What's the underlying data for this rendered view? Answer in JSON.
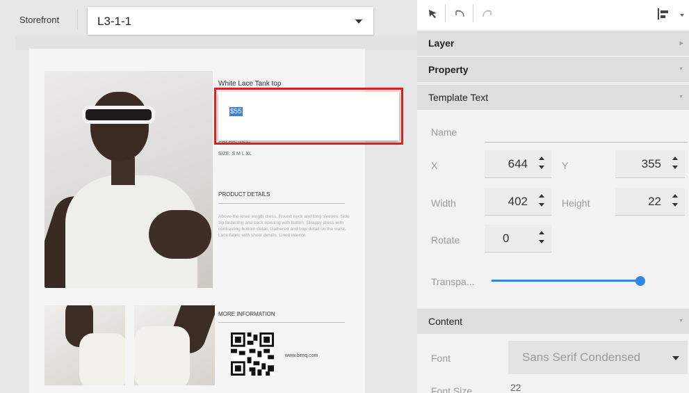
{
  "header": {
    "store_label": "Storefront",
    "template_value": "L3-1-1"
  },
  "preview": {
    "product_title": "White Lace Tank top",
    "price": "$55",
    "color_line": "COLOR: White",
    "size_line": "SIZE: S M L XL",
    "details_title": "PRODUCT DETAILS",
    "details_text": "Above-the-knee length dress. Round neck and long sleeves. Side zip fastening and back opening with button. Strappy dress with contrasting bottom detail. Gathered and bow detail on the waist. Lace fabric with sheer details. Lined interior.",
    "more_title": "MORE INFORMATION",
    "url": "www.benq.com"
  },
  "panel": {
    "sections": {
      "layer": "Layer",
      "property": "Property",
      "template_text": "Template Text",
      "content": "Content"
    },
    "fields": {
      "name_label": "Name",
      "x_label": "X",
      "x_value": "644",
      "y_label": "Y",
      "y_value": "355",
      "width_label": "Width",
      "width_value": "402",
      "height_label": "Height",
      "height_value": "22",
      "rotate_label": "Rotate",
      "rotate_value": "0",
      "transparency_label": "Transpa...",
      "transparency_value": 1.0,
      "font_label": "Font",
      "font_value": "Sans Serif Condensed",
      "font_size_label": "Font Size",
      "font_size_value": "22"
    }
  },
  "colors": {
    "accent": "#2b87e2",
    "selection": "#e02020",
    "text_highlight": "#3d7fd6"
  }
}
